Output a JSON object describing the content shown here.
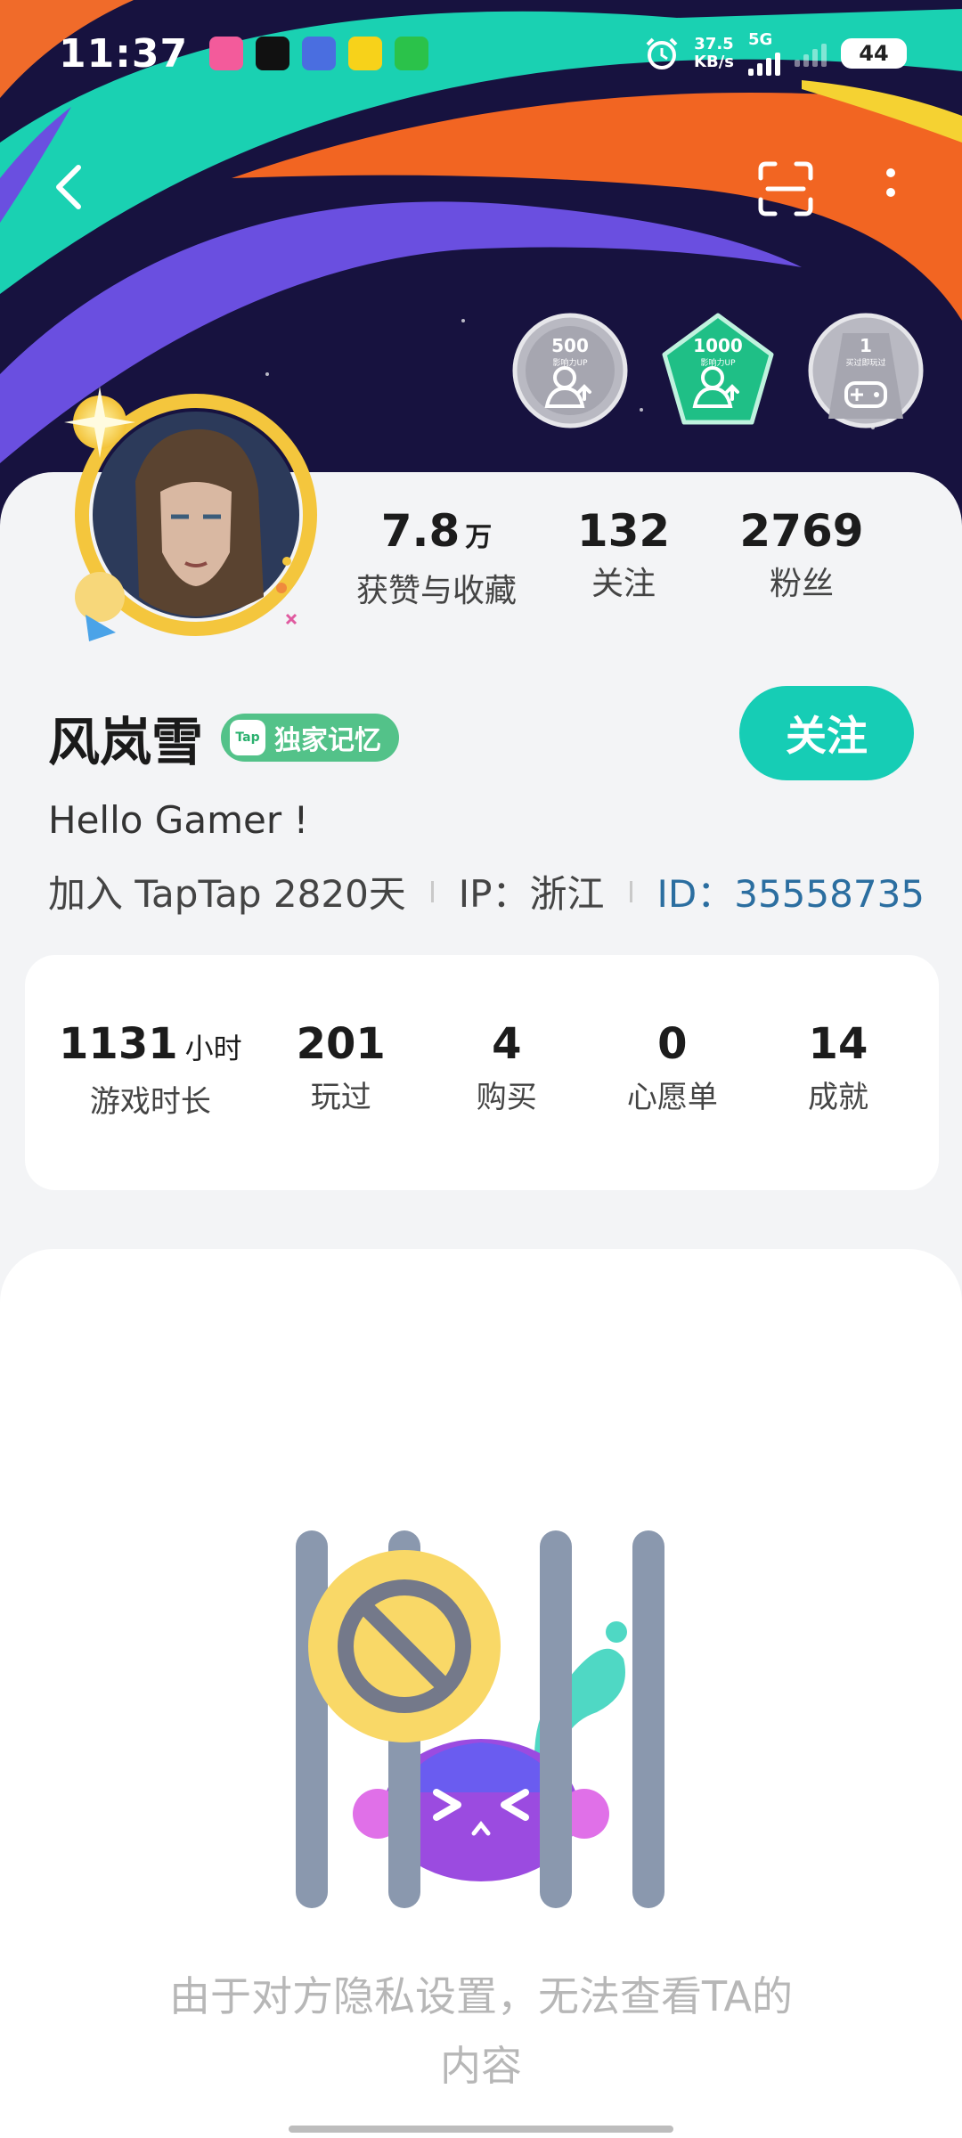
{
  "status_bar": {
    "time": "11:37",
    "net_speed_value": "37.5",
    "net_speed_unit": "KB/s",
    "net_type": "5G",
    "battery": "44"
  },
  "badges": [
    {
      "num": "500",
      "sub": "影响力UP"
    },
    {
      "num": "1000",
      "sub": "影响力UP"
    },
    {
      "num": "1",
      "sub": "买过即玩过"
    }
  ],
  "profile": {
    "stats": [
      {
        "value": "7.8",
        "unit": "万",
        "label": "获赞与收藏"
      },
      {
        "value": "132",
        "unit": "",
        "label": "关注"
      },
      {
        "value": "2769",
        "unit": "",
        "label": "粉丝"
      }
    ],
    "name": "风岚雪",
    "tag_logo": "Tap",
    "tag_label": "独家记忆",
    "follow_label": "关注",
    "bio": "Hello Gamer !",
    "joined": "加入 TapTap 2820天",
    "ip": "IP：浙江",
    "id": "ID：35558735"
  },
  "game_stats": [
    {
      "value": "1131",
      "unit": "小时",
      "label": "游戏时长"
    },
    {
      "value": "201",
      "unit": "",
      "label": "玩过"
    },
    {
      "value": "4",
      "unit": "",
      "label": "购买"
    },
    {
      "value": "0",
      "unit": "",
      "label": "心愿单"
    },
    {
      "value": "14",
      "unit": "",
      "label": "成就"
    }
  ],
  "privacy": {
    "message_line1": "由于对方隐私设置，无法查看TA的",
    "message_line2": "内容"
  },
  "colors": {
    "accent": "#16cdb5",
    "tag": "#53c289",
    "id_link": "#2b6ea0"
  }
}
